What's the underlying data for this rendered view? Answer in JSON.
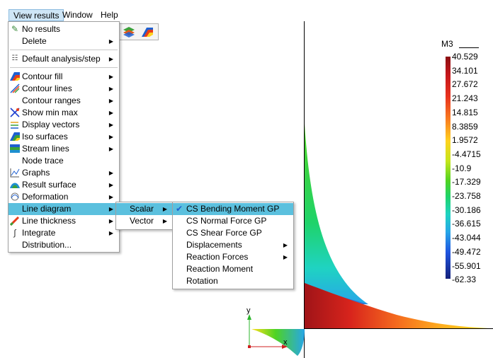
{
  "menubar": {
    "items": [
      {
        "label": "View results",
        "active": true
      },
      {
        "label": "Window",
        "active": false
      },
      {
        "label": "Help",
        "active": false
      }
    ]
  },
  "view_results_menu": {
    "items": [
      {
        "label": "No results",
        "icon": "no-results-icon",
        "submenu": false
      },
      {
        "label": "Delete",
        "icon": "",
        "submenu": true
      },
      {
        "label": "Default analysis/step",
        "icon": "analysis-step-icon",
        "submenu": true
      },
      {
        "label": "Contour fill",
        "icon": "contour-fill-icon",
        "submenu": true
      },
      {
        "label": "Contour lines",
        "icon": "contour-lines-icon",
        "submenu": true
      },
      {
        "label": "Contour ranges",
        "icon": "",
        "submenu": true
      },
      {
        "label": "Show min max",
        "icon": "min-max-icon",
        "submenu": true
      },
      {
        "label": "Display vectors",
        "icon": "vectors-icon",
        "submenu": true
      },
      {
        "label": "Iso surfaces",
        "icon": "iso-surfaces-icon",
        "submenu": true
      },
      {
        "label": "Stream lines",
        "icon": "stream-lines-icon",
        "submenu": true
      },
      {
        "label": "Node trace",
        "icon": "",
        "submenu": false
      },
      {
        "label": "Graphs",
        "icon": "graphs-icon",
        "submenu": true
      },
      {
        "label": "Result surface",
        "icon": "result-surface-icon",
        "submenu": true
      },
      {
        "label": "Deformation",
        "icon": "deformation-icon",
        "submenu": true
      },
      {
        "label": "Line diagram",
        "icon": "",
        "submenu": true
      },
      {
        "label": "Line thickness",
        "icon": "line-thickness-icon",
        "submenu": true
      },
      {
        "label": "Integrate",
        "icon": "integrate-icon",
        "submenu": true
      },
      {
        "label": "Distribution...",
        "icon": "",
        "submenu": false
      }
    ]
  },
  "line_diagram_submenu": {
    "items": [
      {
        "label": "Scalar",
        "submenu": true
      },
      {
        "label": "Vector",
        "submenu": true
      }
    ]
  },
  "scalar_submenu": {
    "items": [
      {
        "label": "CS Bending Moment GP",
        "checked": true,
        "submenu": false
      },
      {
        "label": "CS Normal Force GP",
        "checked": false,
        "submenu": false
      },
      {
        "label": "CS Shear Force GP",
        "checked": false,
        "submenu": false
      },
      {
        "label": "Displacements",
        "checked": false,
        "submenu": true
      },
      {
        "label": "Reaction Forces",
        "checked": false,
        "submenu": true
      },
      {
        "label": "Reaction Moment",
        "checked": false,
        "submenu": false
      },
      {
        "label": "Rotation",
        "checked": false,
        "submenu": false
      }
    ]
  },
  "legend": {
    "title": "M3",
    "values": [
      "40.529",
      "34.101",
      "27.672",
      "21.243",
      "14.815",
      "8.3859",
      "1.9572",
      "-4.4715",
      "-10.9",
      "-17.329",
      "-23.758",
      "-30.186",
      "-36.615",
      "-43.044",
      "-49.472",
      "-55.901",
      "-62.33"
    ]
  },
  "axes": {
    "y_label": "y",
    "x_label": "x"
  },
  "colors": {
    "highlight": "#5bc0de",
    "menu_border": "#a0a0a0"
  }
}
